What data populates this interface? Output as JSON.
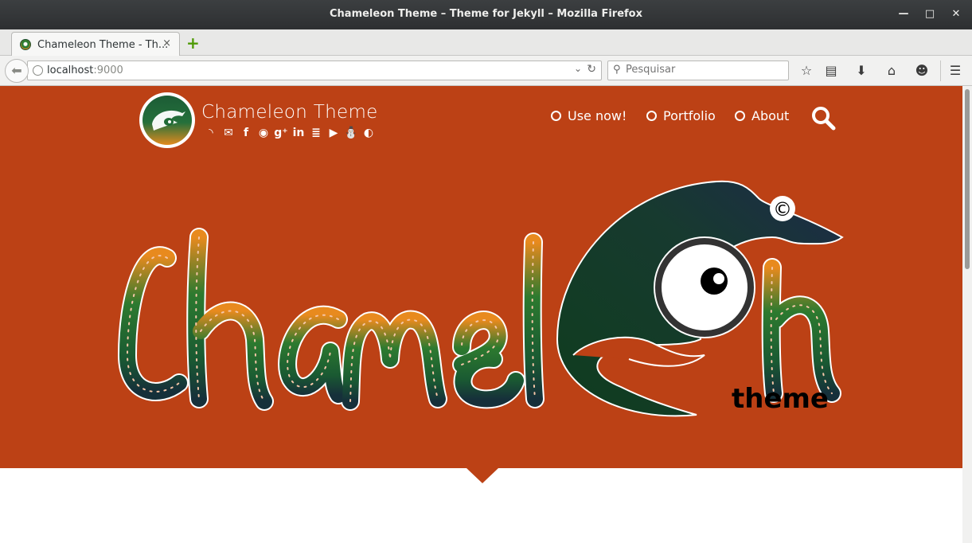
{
  "window": {
    "title": "Chameleon Theme – Theme for Jekyll – Mozilla Firefox"
  },
  "tabs": [
    {
      "label": "Chameleon Theme - Th...",
      "close": "×"
    }
  ],
  "new_tab_symbol": "+",
  "navigation": {
    "url_host": "localhost",
    "url_port": ":9000",
    "search_placeholder": "Pesquisar"
  },
  "toolbar_icons": [
    "bookmark-star-icon",
    "reading-list-icon",
    "download-icon",
    "home-icon",
    "chat-icon",
    "menu-icon"
  ],
  "site": {
    "brand": "Chameleon Theme",
    "social_icons": [
      "rss-icon",
      "email-icon",
      "facebook-icon",
      "github-icon",
      "google-plus-icon",
      "linkedin-icon",
      "stack-icon",
      "youtube-icon",
      "linux-icon",
      "disqus-icon"
    ],
    "menu": [
      {
        "label": "Use now!"
      },
      {
        "label": "Portfolio"
      },
      {
        "label": "About"
      }
    ],
    "hero": {
      "logo_text": "Chameleon",
      "copyright_symbol": "©",
      "subtitle": "theme"
    }
  },
  "colors": {
    "hero_background": "#bc4115",
    "letter_green": "#1f6a35",
    "letter_dark": "#16303a",
    "letter_orange": "#e88a1e"
  }
}
